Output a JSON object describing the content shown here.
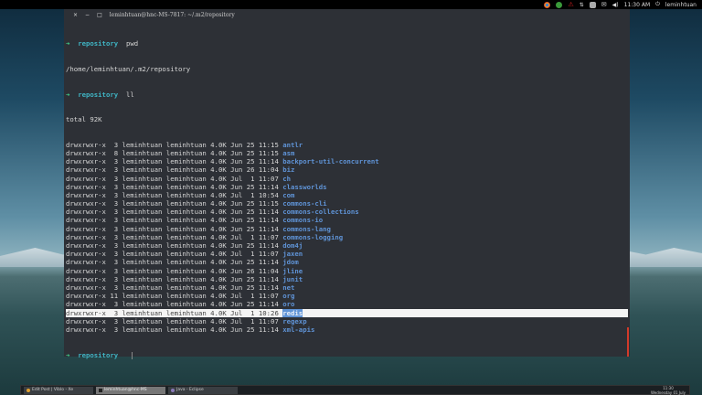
{
  "topbar": {
    "time": "11:30 AM",
    "user": "leminhtuan",
    "icons": [
      "chrome-icon",
      "hangouts-icon",
      "warning-icon",
      "network-icon",
      "keyboard-icon",
      "mail-icon",
      "volume-icon",
      "power-icon"
    ]
  },
  "terminal": {
    "title": "leminhtuan@hnc-MS-7817: ~/.m2/repository",
    "window_buttons": [
      "×",
      "−",
      "□"
    ],
    "prompt_dir": "repository",
    "prompt_arrow": "➜",
    "cmd1": "pwd",
    "pwd_output": "/home/leminhtuan/.m2/repository",
    "cmd2": "ll",
    "total": "total 92K",
    "rows": [
      {
        "meta": "drwxrwxr-x  3 leminhtuan leminhtuan 4.0K Jun 25 11:15 ",
        "name": "antlr"
      },
      {
        "meta": "drwxrwxr-x  8 leminhtuan leminhtuan 4.0K Jun 25 11:15 ",
        "name": "asm"
      },
      {
        "meta": "drwxrwxr-x  3 leminhtuan leminhtuan 4.0K Jun 25 11:14 ",
        "name": "backport-util-concurrent"
      },
      {
        "meta": "drwxrwxr-x  3 leminhtuan leminhtuan 4.0K Jun 26 11:04 ",
        "name": "biz"
      },
      {
        "meta": "drwxrwxr-x  3 leminhtuan leminhtuan 4.0K Jul  1 11:07 ",
        "name": "ch"
      },
      {
        "meta": "drwxrwxr-x  3 leminhtuan leminhtuan 4.0K Jun 25 11:14 ",
        "name": "classworlds"
      },
      {
        "meta": "drwxrwxr-x  3 leminhtuan leminhtuan 4.0K Jul  1 10:54 ",
        "name": "com"
      },
      {
        "meta": "drwxrwxr-x  3 leminhtuan leminhtuan 4.0K Jun 25 11:15 ",
        "name": "commons-cli"
      },
      {
        "meta": "drwxrwxr-x  3 leminhtuan leminhtuan 4.0K Jun 25 11:14 ",
        "name": "commons-collections"
      },
      {
        "meta": "drwxrwxr-x  3 leminhtuan leminhtuan 4.0K Jun 25 11:14 ",
        "name": "commons-io"
      },
      {
        "meta": "drwxrwxr-x  3 leminhtuan leminhtuan 4.0K Jun 25 11:14 ",
        "name": "commons-lang"
      },
      {
        "meta": "drwxrwxr-x  3 leminhtuan leminhtuan 4.0K Jul  1 11:07 ",
        "name": "commons-logging"
      },
      {
        "meta": "drwxrwxr-x  3 leminhtuan leminhtuan 4.0K Jun 25 11:14 ",
        "name": "dom4j"
      },
      {
        "meta": "drwxrwxr-x  3 leminhtuan leminhtuan 4.0K Jul  1 11:07 ",
        "name": "jaxen"
      },
      {
        "meta": "drwxrwxr-x  3 leminhtuan leminhtuan 4.0K Jun 25 11:14 ",
        "name": "jdom"
      },
      {
        "meta": "drwxrwxr-x  3 leminhtuan leminhtuan 4.0K Jun 26 11:04 ",
        "name": "jline"
      },
      {
        "meta": "drwxrwxr-x  3 leminhtuan leminhtuan 4.0K Jun 25 11:14 ",
        "name": "junit"
      },
      {
        "meta": "drwxrwxr-x  3 leminhtuan leminhtuan 4.0K Jun 25 11:14 ",
        "name": "net"
      },
      {
        "meta": "drwxrwxr-x 11 leminhtuan leminhtuan 4.0K Jul  1 11:07 ",
        "name": "org"
      },
      {
        "meta": "drwxrwxr-x  3 leminhtuan leminhtuan 4.0K Jun 25 11:14 ",
        "name": "oro"
      },
      {
        "meta": "drwxrwxr-x  3 leminhtuan leminhtuan 4.0K Jul  1 10:26 ",
        "name": "redis",
        "highlighted": true
      },
      {
        "meta": "drwxrwxr-x  3 leminhtuan leminhtuan 4.0K Jul  1 11:07 ",
        "name": "regexp"
      },
      {
        "meta": "drwxrwxr-x  3 leminhtuan leminhtuan 4.0K Jun 25 11:14 ",
        "name": "xml-apis"
      }
    ]
  },
  "taskbar": {
    "tasks": [
      {
        "label": "Edit Post | Viblo - Xe",
        "active": false
      },
      {
        "label": "leminhtuan@hnc-MS",
        "active": true
      },
      {
        "label": "Java - Eclipse",
        "active": false
      }
    ],
    "clock_time": "11:30",
    "clock_date": "Wednesday 01 July"
  }
}
